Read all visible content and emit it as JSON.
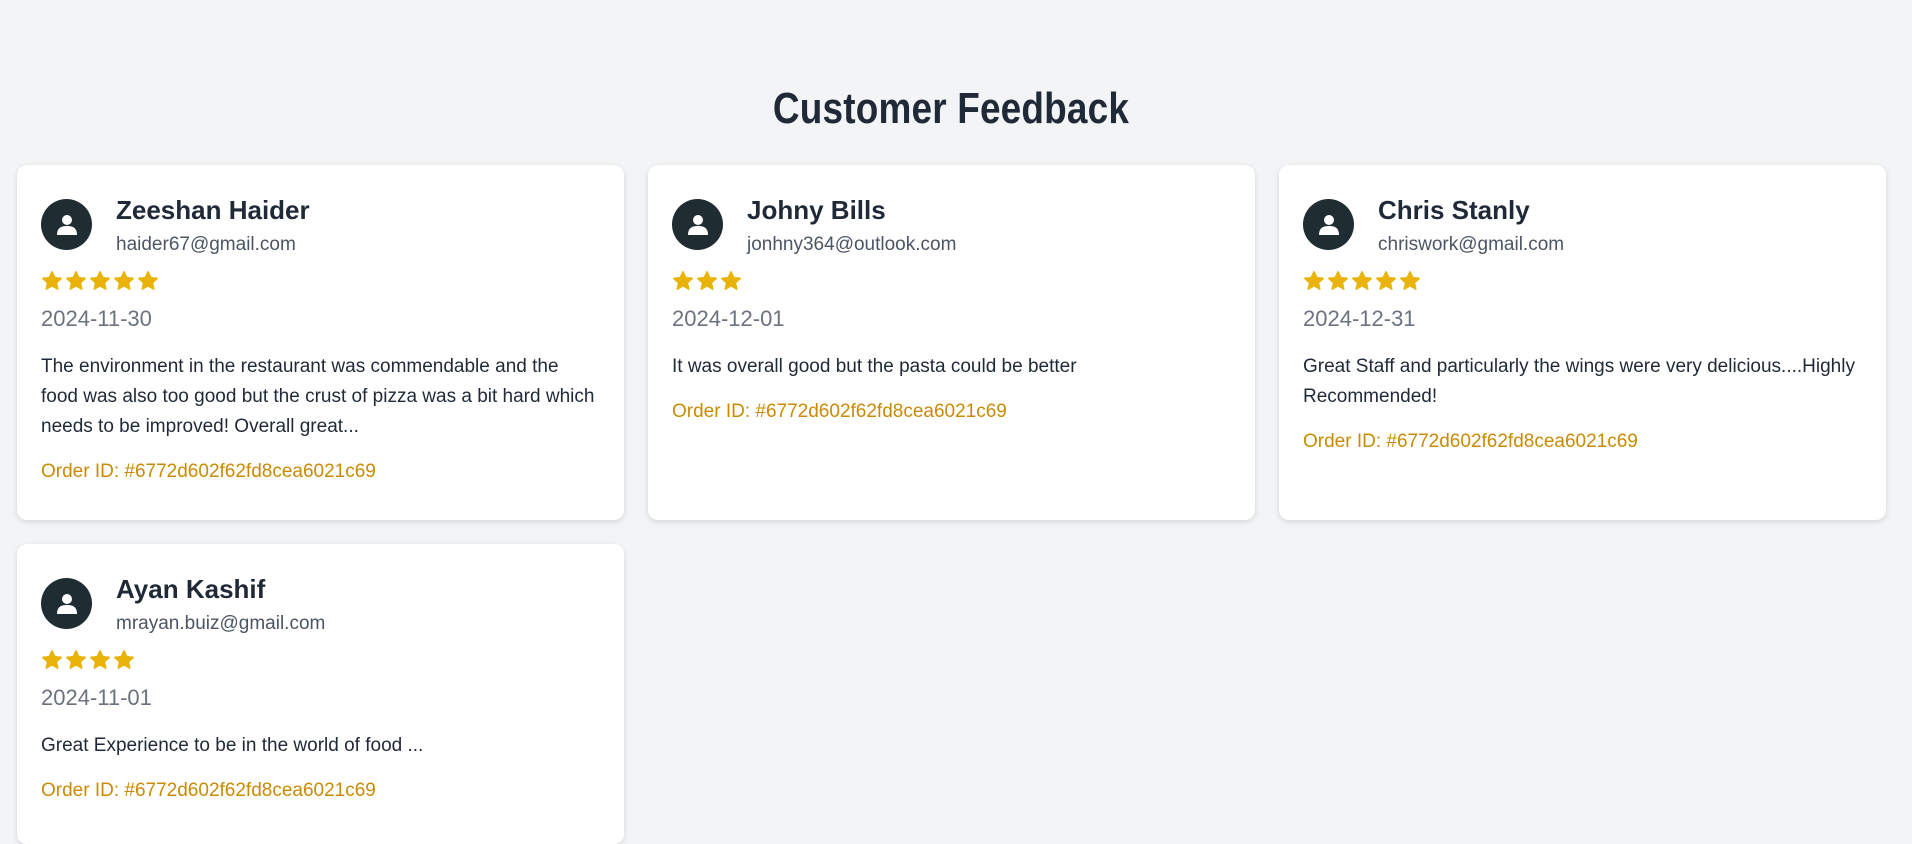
{
  "page": {
    "title": "Customer Feedback"
  },
  "colors": {
    "background": "#f3f4f6",
    "card": "#ffffff",
    "star": "#eab308",
    "order_id": "#ca8a04",
    "avatar": "#1f2d33"
  },
  "feedbacks": [
    {
      "name": "Zeeshan Haider",
      "email": "haider67@gmail.com",
      "rating": 5,
      "date": "2024-11-30",
      "comment": "The environment in the restaurant was commendable and the food was also too good but the crust of pizza was a bit hard which needs to be improved! Overall great...",
      "order_id": "Order ID: #6772d602f62fd8cea6021c69",
      "avatar_icon": "user-avatar-icon"
    },
    {
      "name": "Johny Bills",
      "email": "jonhny364@outlook.com",
      "rating": 3,
      "date": "2024-12-01",
      "comment": "It was overall good but the pasta could be better",
      "order_id": "Order ID: #6772d602f62fd8cea6021c69",
      "avatar_icon": "user-avatar-icon"
    },
    {
      "name": "Chris Stanly",
      "email": "chriswork@gmail.com",
      "rating": 5,
      "date": "2024-12-31",
      "comment": "Great Staff and particularly the wings were very delicious....Highly Recommended!",
      "order_id": "Order ID: #6772d602f62fd8cea6021c69",
      "avatar_icon": "user-avatar-icon"
    },
    {
      "name": "Ayan Kashif",
      "email": "mrayan.buiz@gmail.com",
      "rating": 4,
      "date": "2024-11-01",
      "comment": "Great Experience to be in the world of food ...",
      "order_id": "Order ID: #6772d602f62fd8cea6021c69",
      "avatar_icon": "user-avatar-icon"
    }
  ]
}
